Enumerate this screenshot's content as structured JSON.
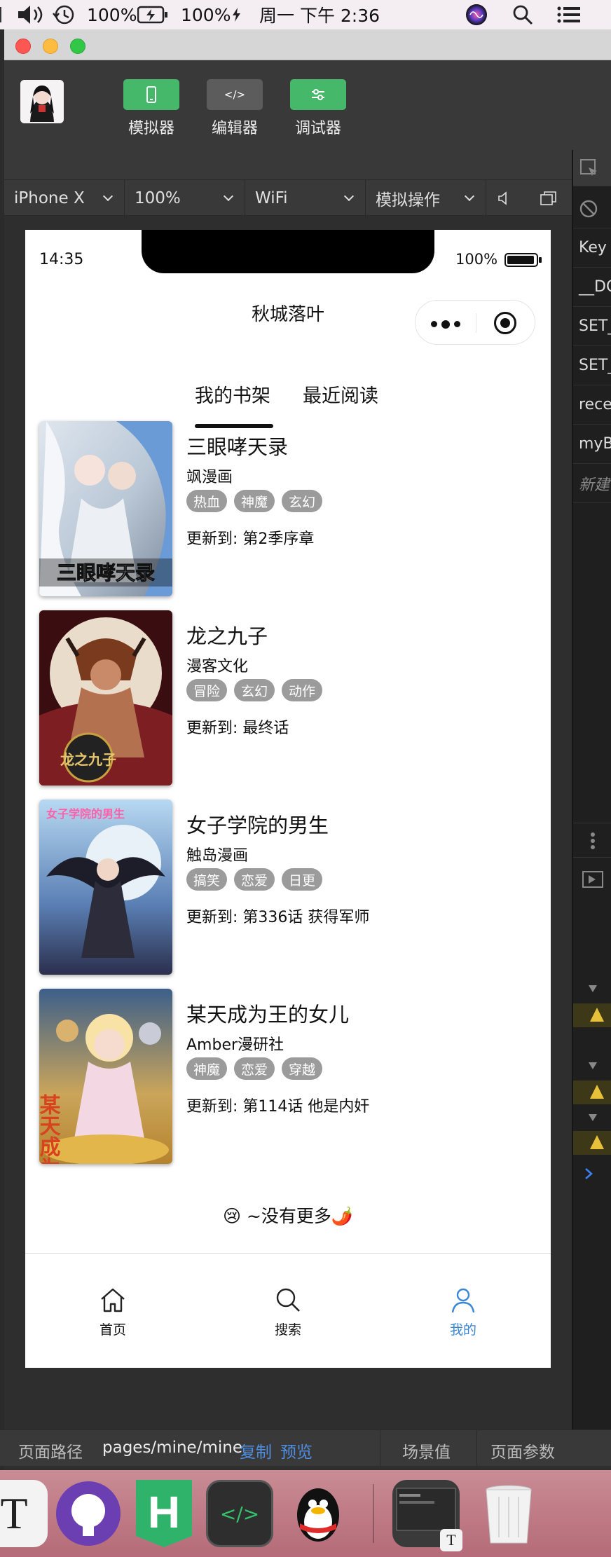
{
  "menubar": {
    "battery_1": "100%",
    "battery_2": "100%",
    "datetime": "周一 下午 2:36"
  },
  "toolbar": {
    "simulator_label": "模拟器",
    "editor_label": "编辑器",
    "debugger_label": "调试器",
    "editor_icon_text": "</>"
  },
  "devbar": {
    "device": "iPhone X",
    "zoom": "100%",
    "network": "WiFi",
    "simulate": "模拟操作"
  },
  "storage_panel": {
    "rows": [
      "Key",
      "__DC",
      "SET_",
      "SET_",
      "rece",
      "myB",
      "新建"
    ]
  },
  "phone": {
    "time": "14:35",
    "battery": "100%",
    "nav_title": "秋城落叶",
    "tabs": [
      "我的书架",
      "最近阅读"
    ],
    "books": [
      {
        "title": "三眼哮天录",
        "author": "飒漫画",
        "tags": [
          "热血",
          "神魔",
          "玄幻"
        ],
        "update": "更新到: 第2季序章",
        "cover_text": "三眼哮天录"
      },
      {
        "title": "龙之九子",
        "author": "漫客文化",
        "tags": [
          "冒险",
          "玄幻",
          "动作"
        ],
        "update": "更新到: 最终话",
        "cover_text": "龙之九子"
      },
      {
        "title": "女子学院的男生",
        "author": "触岛漫画",
        "tags": [
          "搞笑",
          "恋爱",
          "日更"
        ],
        "update": "更新到: 第336话 获得军师",
        "cover_text": "女子学院的男生"
      },
      {
        "title": "某天成为王的女儿",
        "author": "Amber漫研社",
        "tags": [
          "神魔",
          "恋爱",
          "穿越"
        ],
        "update": "更新到: 第114话 他是内奸",
        "cover_text": "某天成为"
      }
    ],
    "no_more": "😢 ~没有更多🌶️",
    "tabbar": [
      "首页",
      "搜索",
      "我的"
    ],
    "active_color": "#3a86d6"
  },
  "pathbar": {
    "label": "页面路径",
    "path": "pages/mine/mine",
    "copy": "复制",
    "preview": "预览",
    "scene": "场景值",
    "params": "页面参数"
  },
  "dock": {
    "items": [
      "T",
      "GitHub",
      "H",
      "</>",
      "QQ",
      "T",
      "Trash"
    ]
  }
}
